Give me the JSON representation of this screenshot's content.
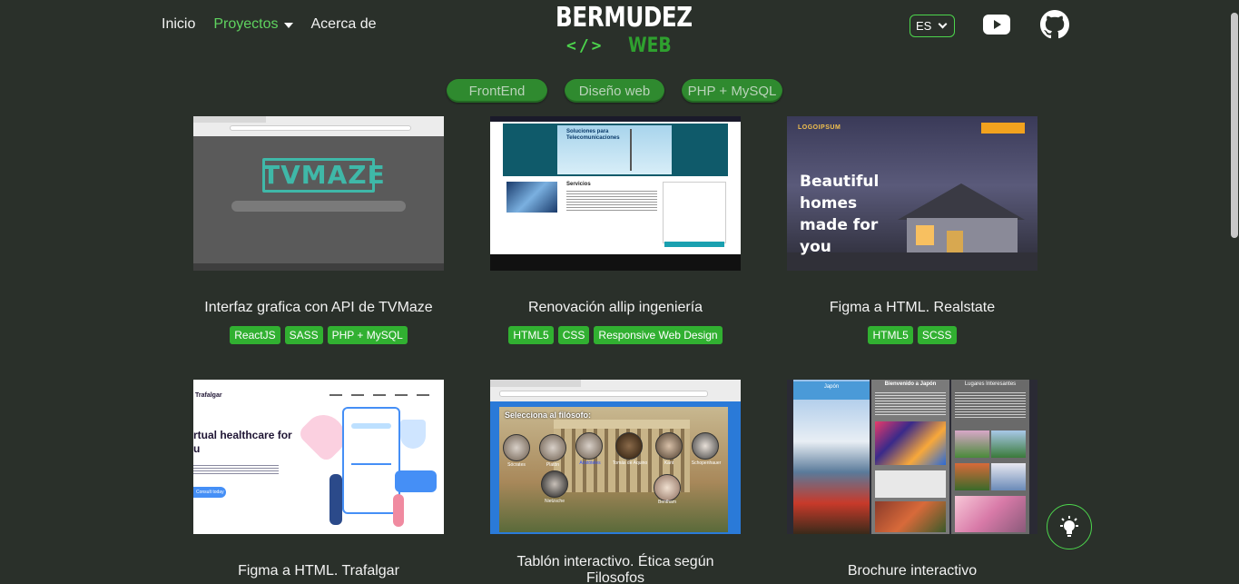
{
  "nav": {
    "items": [
      {
        "label": "Inicio",
        "active": false
      },
      {
        "label": "Proyectos",
        "active": true,
        "has_dropdown": true
      },
      {
        "label": "Acerca de",
        "active": false
      }
    ]
  },
  "logo": {
    "main": "BERMUDEZ",
    "code": "</>",
    "sub": "WEB"
  },
  "language": {
    "selected": "ES"
  },
  "social": [
    "youtube-icon",
    "github-icon"
  ],
  "filters": [
    "FrontEnd",
    "Diseño web",
    "PHP + MySQL"
  ],
  "projects": [
    {
      "title": "Interfaz grafica con API de TVMaze",
      "tags": [
        "ReactJS",
        "SASS",
        "PHP + MySQL"
      ],
      "thumb": {
        "logo": "TVMAZE"
      }
    },
    {
      "title": "Renovación allip ingeniería",
      "tags": [
        "HTML5",
        "CSS",
        "Responsive Web Design"
      ],
      "thumb": {
        "banner": "Soluciones para Telecomunicaciones",
        "section": "Servicios"
      }
    },
    {
      "title": "Figma a HTML. Realstate",
      "tags": [
        "HTML5",
        "SCSS"
      ],
      "thumb": {
        "brand": "LOGOIPSUM",
        "headline": "Beautiful homes made for you"
      }
    },
    {
      "title": "Figma a HTML. Trafalgar",
      "tags": [],
      "thumb": {
        "brand": "Trafalgar",
        "headline": "rtual healthcare for u",
        "cta": "Consult today"
      }
    },
    {
      "title": "Tablón interactivo. Ética según Filosofos",
      "tags": [],
      "thumb": {
        "heading": "Selecciona al filósofo:",
        "names": [
          "Sócrates",
          "Platón",
          "Aristóteles",
          "Tomás de Aquino",
          "Kant",
          "Schopenhauer",
          "Nietzsche",
          "Bentham"
        ]
      }
    },
    {
      "title": "Brochure interactivo",
      "tags": [],
      "thumb": {
        "col1": "Japón",
        "col2": "Bienvenido a Japón",
        "col3": "Lugares Interesantes"
      }
    }
  ],
  "colors": {
    "background": "#2a302a",
    "accent": "#4cd44c",
    "tag": "#31b031",
    "filter": "#2f8a2f"
  }
}
